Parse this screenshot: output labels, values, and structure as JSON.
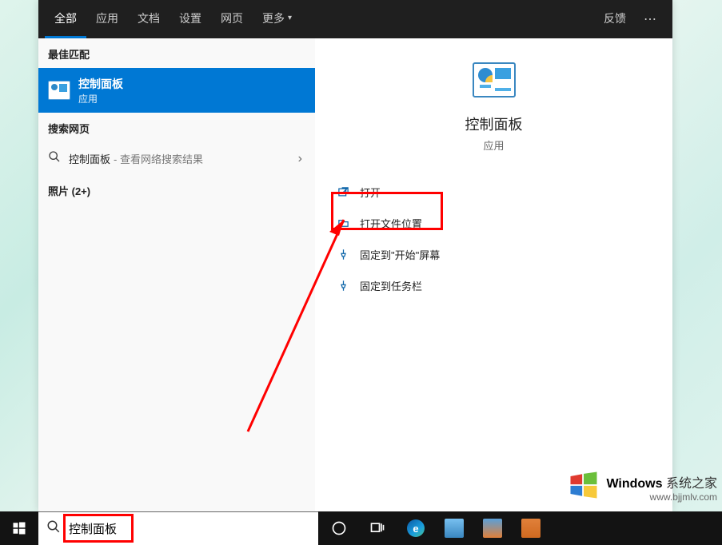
{
  "tabs": {
    "all": "全部",
    "apps": "应用",
    "docs": "文档",
    "settings": "设置",
    "web": "网页",
    "more": "更多",
    "feedback": "反馈"
  },
  "sections": {
    "best_match": "最佳匹配",
    "search_web": "搜索网页",
    "photos": "照片 (2+)"
  },
  "best_match_item": {
    "title": "控制面板",
    "subtitle": "应用"
  },
  "web_item": {
    "term": "控制面板",
    "desc": "- 查看网络搜索结果"
  },
  "preview": {
    "title": "控制面板",
    "subtitle": "应用"
  },
  "actions": {
    "open": "打开",
    "open_location": "打开文件位置",
    "pin_start": "固定到\"开始\"屏幕",
    "pin_taskbar": "固定到任务栏"
  },
  "search_input": {
    "value": "控制面板"
  },
  "watermark": {
    "brand": "Windows",
    "suffix": "系统之家",
    "url": "www.bjjmlv.com"
  }
}
